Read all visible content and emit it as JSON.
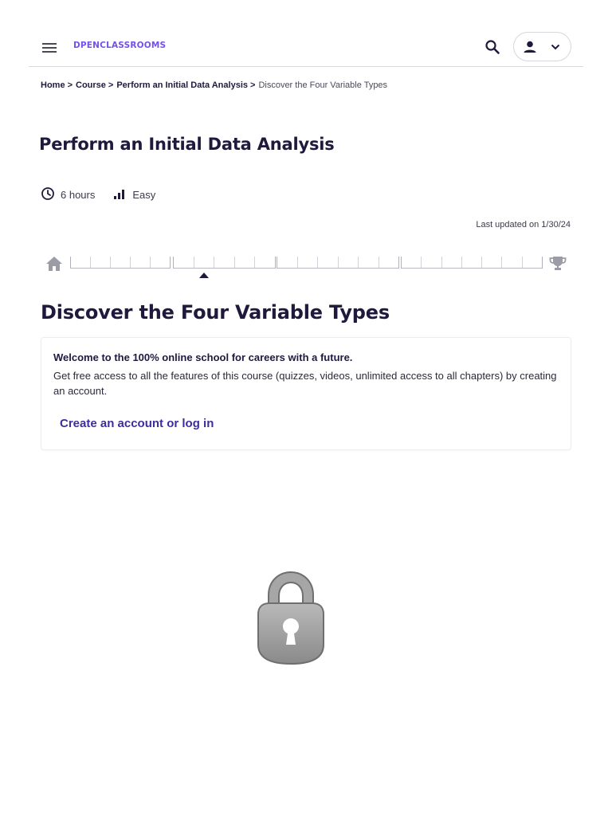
{
  "header": {
    "logo_text": "DPENCLASSROOMS",
    "menu_icon": "hamburger-icon",
    "search_icon": "search-icon",
    "user_icon": "person-icon",
    "user_chevron": "chevron-down-icon",
    "brand_color": "#7451eb"
  },
  "breadcrumb": {
    "items": [
      "Home",
      "Course",
      "Perform an Initial Data Analysis"
    ],
    "separator": ">",
    "current": "Discover the Four Variable Types"
  },
  "course": {
    "title": "Perform an Initial Data Analysis",
    "duration": "6 hours",
    "duration_icon": "clock-icon",
    "difficulty": "Easy",
    "difficulty_icon": "signal-bars-icon",
    "last_updated": "Last updated on 1/30/24"
  },
  "progress": {
    "start_icon": "home-icon",
    "end_icon": "trophy-icon"
  },
  "chapter": {
    "title": "Discover the Four Variable Types"
  },
  "signup_card": {
    "heading": "Welcome to the 100% online school for careers with a future.",
    "body": "Get free access to all the features of this course (quizzes, videos, unlimited access to all chapters) by creating an account.",
    "link_text": "Create an account or log in",
    "link_color": "#3f2c9e"
  },
  "locked_content": {
    "icon": "padlock-icon"
  }
}
